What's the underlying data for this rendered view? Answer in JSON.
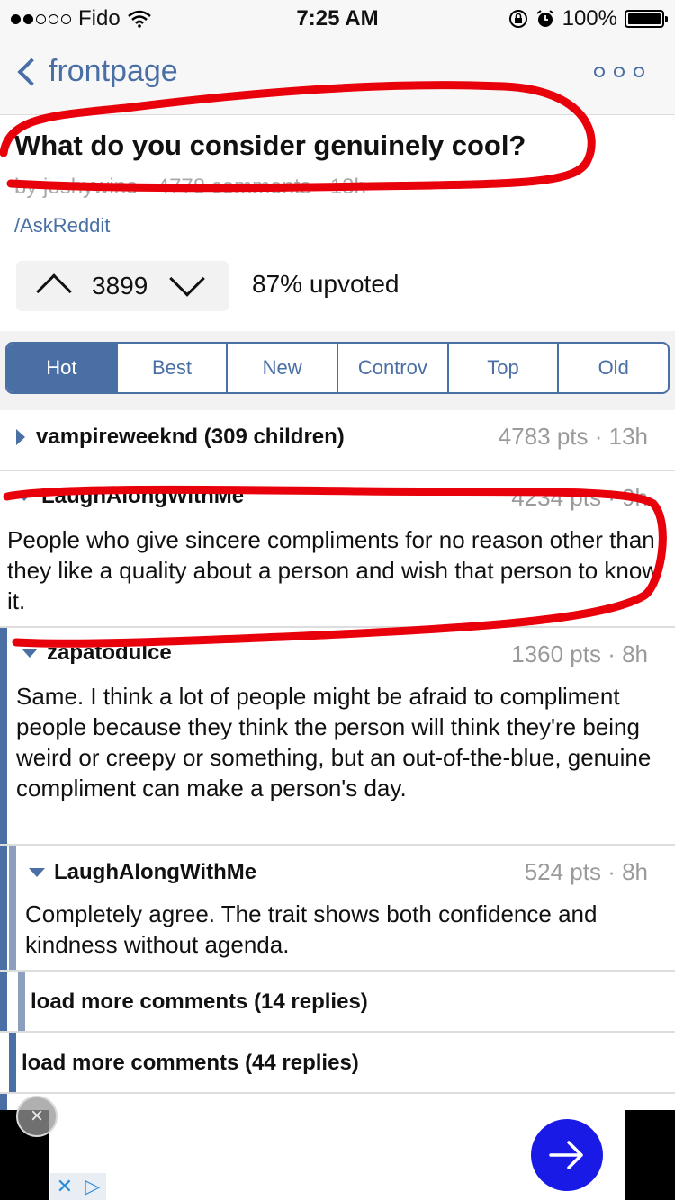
{
  "status_bar": {
    "carrier": "Fido",
    "time": "7:25 AM",
    "battery_pct": "100%"
  },
  "nav": {
    "back_label": "frontpage"
  },
  "post": {
    "title": "What do you consider genuinely cool?",
    "meta": "by joshywine · 4778 comments · 13h",
    "subreddit": "/AskReddit",
    "score": "3899",
    "upvoted": "87% upvoted"
  },
  "tabs": [
    "Hot",
    "Best",
    "New",
    "Controv",
    "Top",
    "Old"
  ],
  "comments": [
    {
      "author": "vampireweeknd (309 children)",
      "points": "4783 pts · 13h"
    },
    {
      "author": "LaughAlongWithMe",
      "points": "4234 pts · 9h",
      "body": "People who give sincere compliments for no reason other than they like a quality about a person and wish that person to know it."
    },
    {
      "author": "zapatodulce",
      "points": "1360 pts · 8h",
      "body": "Same. I think a lot of people might be afraid to compliment people because they think the person will think they're being weird or creepy or something, but an out-of-the-blue, genuine compliment can make a person's day."
    },
    {
      "author": "LaughAlongWithMe",
      "points": "524 pts · 8h",
      "body": "Completely agree. The trait shows both confidence and kindness without agenda."
    }
  ],
  "load_more": [
    "load more comments (14 replies)",
    "load more comments (44 replies)"
  ],
  "ad": {
    "close_glyph": "×",
    "choices_x": "✕",
    "choices_play": "▷"
  },
  "colors": {
    "accent": "#4a6fa5",
    "annotation": "#e8000b",
    "ad_button": "#1a1ae6"
  }
}
